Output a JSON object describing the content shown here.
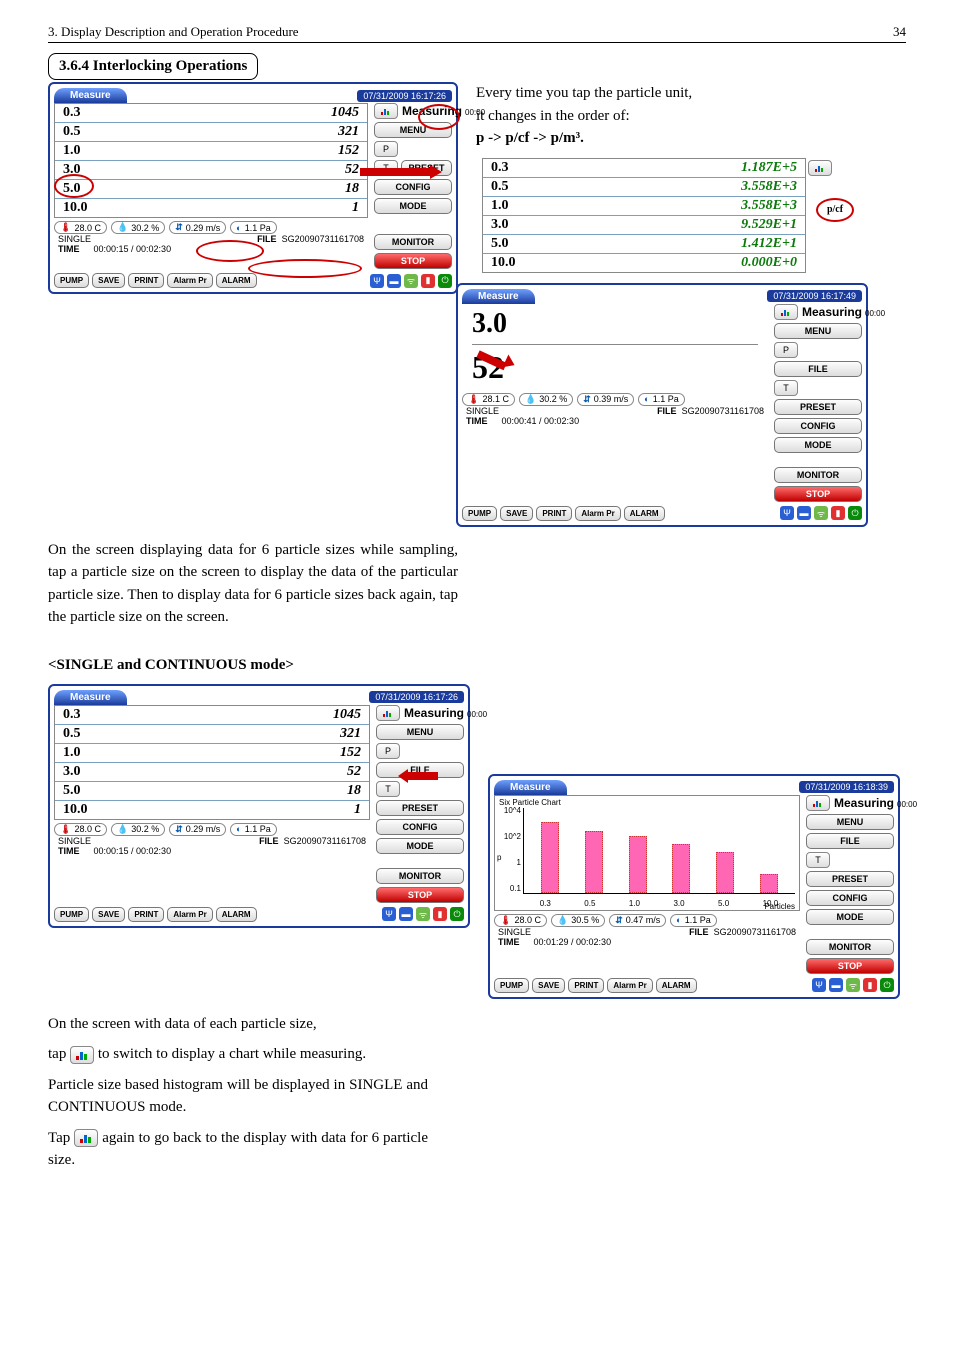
{
  "header": {
    "left": "3. Display Description and Operation Procedure",
    "page": "34"
  },
  "section_title": "3.6.4 Interlocking Operations",
  "intro": {
    "line1": "Every time you tap the particle unit,",
    "line2": "it changes in the order of:",
    "cycle": "p -> p/cf -> p/m³."
  },
  "para1": "On the screen displaying data for 6 particle sizes while sampling, tap a particle size on the screen to display the data of the particular particle size. Then to display data for 6 particle sizes back again, tap the particle size on the screen.",
  "subheading": "<SINGLE and CONTINUOUS mode>",
  "para2a": "On the screen with data of each particle size,",
  "para2b_pre": "tap ",
  "para2b_post": " to switch to display a chart while measuring.",
  "para2c": "Particle size based histogram will be displayed in SINGLE and CONTINUOUS mode.",
  "para2d_pre": "Tap ",
  "para2d_post": " again to go back to the display with data for 6 particle size.",
  "device_common": {
    "tab": "Measure",
    "btn_menu": "MENU",
    "btn_file": "FILE",
    "btn_preset": "PRESET",
    "btn_config": "CONFIG",
    "btn_mode": "MODE",
    "btn_monitor": "MONITOR",
    "btn_stop": "STOP",
    "btn_pump": "PUMP",
    "btn_save": "SAVE",
    "btn_print": "PRINT",
    "btn_alarmpr": "Alarm Pr",
    "btn_alarm": "ALARM",
    "measuring": "Measuring",
    "p_btn": "P",
    "t_btn": "T",
    "meta_mode": "SINGLE",
    "meta_file_label": "FILE",
    "meta_time_label": "TIME"
  },
  "screen_a": {
    "timestamp": "07/31/2009 16:17:26",
    "sec": "00:00",
    "rows": [
      {
        "size": "0.3",
        "val": "1045"
      },
      {
        "size": "0.5",
        "val": "321"
      },
      {
        "size": "1.0",
        "val": "152"
      },
      {
        "size": "3.0",
        "val": "52"
      },
      {
        "size": "5.0",
        "val": "18"
      },
      {
        "size": "10.0",
        "val": "1"
      }
    ],
    "temp": "28.0 C",
    "hum": "30.2 %",
    "flow": "0.29 m/s",
    "press": "1.1 Pa",
    "file": "SG20090731161708",
    "time": "00:00:15 / 00:02:30"
  },
  "screen_b": {
    "rows": [
      {
        "size": "0.3",
        "val": "1.187E+5"
      },
      {
        "size": "0.5",
        "val": "3.558E+3"
      },
      {
        "size": "1.0",
        "val": "3.558E+3"
      },
      {
        "size": "3.0",
        "val": "9.529E+1"
      },
      {
        "size": "5.0",
        "val": "1.412E+1"
      },
      {
        "size": "10.0",
        "val": "0.000E+0"
      }
    ],
    "unit_callout": "p/cf"
  },
  "screen_c": {
    "timestamp": "07/31/2009 16:17:49",
    "sec": "00:00",
    "size": "3.0",
    "count": "52",
    "temp": "28.1 C",
    "hum": "30.2 %",
    "flow": "0.39 m/s",
    "press": "1.1 Pa",
    "file": "SG20090731161708",
    "time": "00:00:41 / 00:02:30"
  },
  "screen_d": {
    "timestamp": "07/31/2009 16:17:26",
    "sec": "00:00",
    "rows": [
      {
        "size": "0.3",
        "val": "1045"
      },
      {
        "size": "0.5",
        "val": "321"
      },
      {
        "size": "1.0",
        "val": "152"
      },
      {
        "size": "3.0",
        "val": "52"
      },
      {
        "size": "5.0",
        "val": "18"
      },
      {
        "size": "10.0",
        "val": "1"
      }
    ],
    "temp": "28.0 C",
    "hum": "30.2 %",
    "flow": "0.29 m/s",
    "press": "1.1 Pa",
    "file": "SG20090731161708",
    "time": "00:00:15 / 00:02:30"
  },
  "screen_e": {
    "timestamp": "07/31/2009 16:18:39",
    "sec": "00:00",
    "chart_title": "Six Particle Chart",
    "temp": "28.0 C",
    "hum": "30.5 %",
    "flow": "0.47 m/s",
    "press": "1.1 Pa",
    "file": "SG20090731161708",
    "time": "00:01:29 / 00:02:30",
    "p_label": "p",
    "x_label": "Particles"
  },
  "chart_data": {
    "type": "bar",
    "title": "Six Particle Chart",
    "xlabel": "Particles",
    "ylabel": "p",
    "yscale": "log",
    "yticks": [
      "10^4",
      "10^2",
      "1",
      "0.1"
    ],
    "ylim": [
      0.1,
      10000
    ],
    "categories": [
      "0.3",
      "0.5",
      "1.0",
      "3.0",
      "5.0",
      "10.0"
    ],
    "values": [
      1045,
      321,
      152,
      52,
      18,
      1
    ]
  }
}
